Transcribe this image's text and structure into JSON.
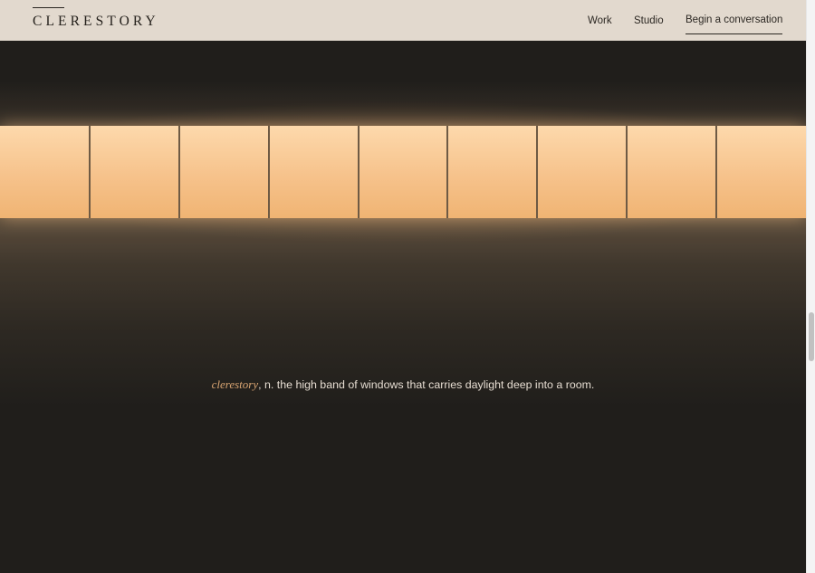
{
  "header": {
    "logo": "CLERESTORY",
    "nav": [
      {
        "label": "Work"
      },
      {
        "label": "Studio"
      }
    ],
    "cta_label": "Begin a conversation"
  },
  "hero": {
    "window_panes": 9,
    "glow_color": "#f6c28b"
  },
  "definition": {
    "term": "clerestory",
    "text": ", n. the high band of windows that carries daylight deep into a room."
  },
  "colors": {
    "header_bg": "#e2d9ce",
    "page_bg": "#201e1b",
    "accent": "#d9a572"
  }
}
